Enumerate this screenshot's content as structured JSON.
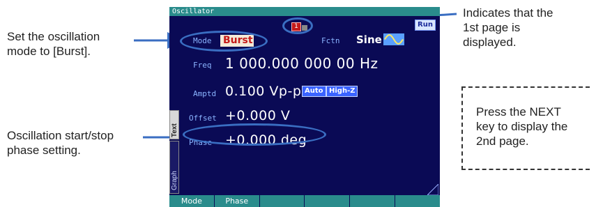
{
  "annotations": {
    "mode_line1": "Set the oscillation",
    "mode_line2": "mode to [Burst].",
    "phase_line1": "Oscillation start/stop",
    "phase_line2": "phase setting.",
    "page_line1": "Indicates that the",
    "page_line2": "1st page is",
    "page_line3": "displayed.",
    "next_line1": "Press the NEXT",
    "next_line2": "key to display the",
    "next_line3": "2nd page."
  },
  "screen": {
    "title": "Oscillator",
    "page_indicator": "1",
    "run_badge": "Run",
    "mode_label": "Mode",
    "mode_value": "Burst",
    "fctn_label": "Fctn",
    "fctn_value": "Sine",
    "freq_label": "Freq",
    "freq_value": "1 000.000 000 00 Hz",
    "amptd_label": "Amptd",
    "amptd_value": "0.100 Vp-p",
    "auto_badge": "Auto",
    "highz_badge": "High-Z",
    "offset_label": "Offset",
    "offset_value": "+0.000 V",
    "phase_label": "Phase",
    "phase_value": "+0.000 deg",
    "side_tab_text": "Text",
    "side_tab_graph": "Graph",
    "next_marker": "N"
  },
  "softkeys": [
    "Mode",
    "Phase",
    "",
    "",
    "",
    ""
  ],
  "colors": {
    "screen_bg": "#0a0a55",
    "bar": "#2a8c8c",
    "annotation_blue": "#3a6ec2",
    "mode_value_text": "#c41a1a"
  }
}
